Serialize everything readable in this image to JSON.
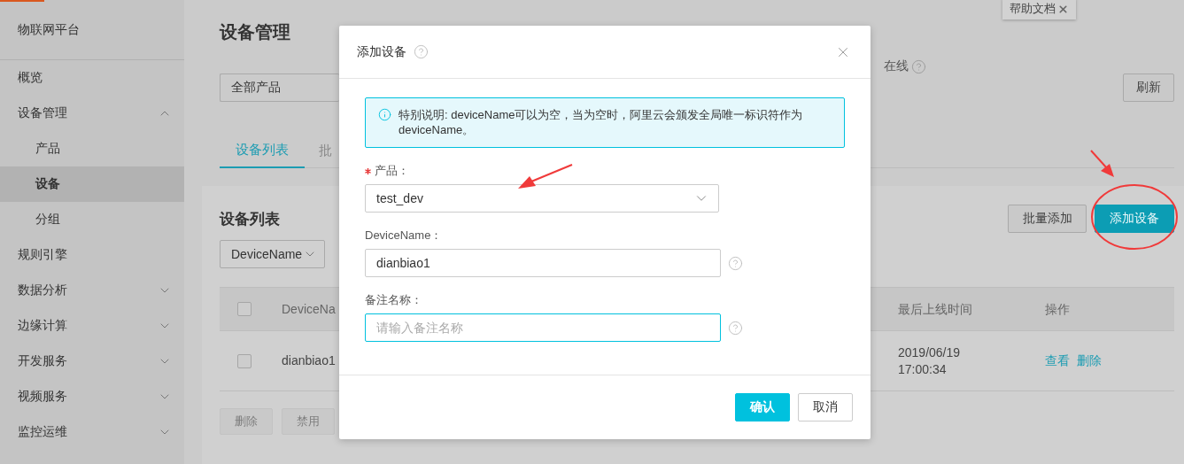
{
  "help_tab": {
    "label": "帮助文档"
  },
  "sidebar": {
    "title": "物联网平台",
    "items": [
      {
        "kind": "link",
        "label": "概览",
        "selected": false
      },
      {
        "kind": "group",
        "label": "设备管理",
        "expanded": true,
        "selected": false,
        "children": [
          {
            "label": "产品",
            "selected": false
          },
          {
            "label": "设备",
            "selected": true
          },
          {
            "label": "分组",
            "selected": false
          }
        ]
      },
      {
        "kind": "link",
        "label": "规则引擎",
        "selected": false
      },
      {
        "kind": "group",
        "label": "数据分析",
        "expanded": false,
        "selected": false
      },
      {
        "kind": "group",
        "label": "边缘计算",
        "expanded": false,
        "selected": false
      },
      {
        "kind": "group",
        "label": "开发服务",
        "expanded": false,
        "selected": false
      },
      {
        "kind": "group",
        "label": "视频服务",
        "expanded": false,
        "selected": false
      },
      {
        "kind": "group",
        "label": "监控运维",
        "expanded": false,
        "selected": false
      }
    ]
  },
  "page": {
    "title": "设备管理",
    "product_filter": "全部产品",
    "online_label": "在线",
    "refresh_button": "刷新",
    "tabs": [
      {
        "label": "设备列表",
        "selected": true
      },
      {
        "label": "批",
        "selected": false
      }
    ],
    "card": {
      "title": "设备列表",
      "buttons": [
        {
          "label": "批量添加",
          "kind": "default"
        },
        {
          "label": "添加设备",
          "kind": "primary"
        }
      ],
      "search_type": "DeviceName",
      "table": {
        "header_checked": false,
        "columns": [
          "DeviceNa",
          "最后上线时间",
          "操作"
        ],
        "rows": [
          {
            "checked": false,
            "name": "dianbiao1",
            "last_online": "2019/06/19\n17:00:34",
            "actions": [
              "查看",
              "删除"
            ]
          }
        ]
      },
      "bulk_buttons": [
        {
          "label": "删除",
          "disabled": true
        },
        {
          "label": "禁用",
          "disabled": true
        }
      ]
    }
  },
  "dialog": {
    "title": "添加设备",
    "notice": "特别说明: deviceName可以为空，当为空时，阿里云会颁发全局唯一标识符作为deviceName。",
    "fields": [
      {
        "kind": "select",
        "label": "产品：",
        "required": true,
        "value": "test_dev",
        "help": false,
        "focused": false
      },
      {
        "kind": "input",
        "label": "DeviceName：",
        "required": false,
        "value": "dianbiao1",
        "help": true,
        "focused": false
      },
      {
        "kind": "input",
        "label": "备注名称：",
        "required": false,
        "placeholder": "请输入备注名称",
        "help": true,
        "focused": true
      }
    ],
    "buttons": [
      {
        "label": "确认",
        "kind": "primary"
      },
      {
        "label": "取消",
        "kind": "default"
      }
    ]
  }
}
